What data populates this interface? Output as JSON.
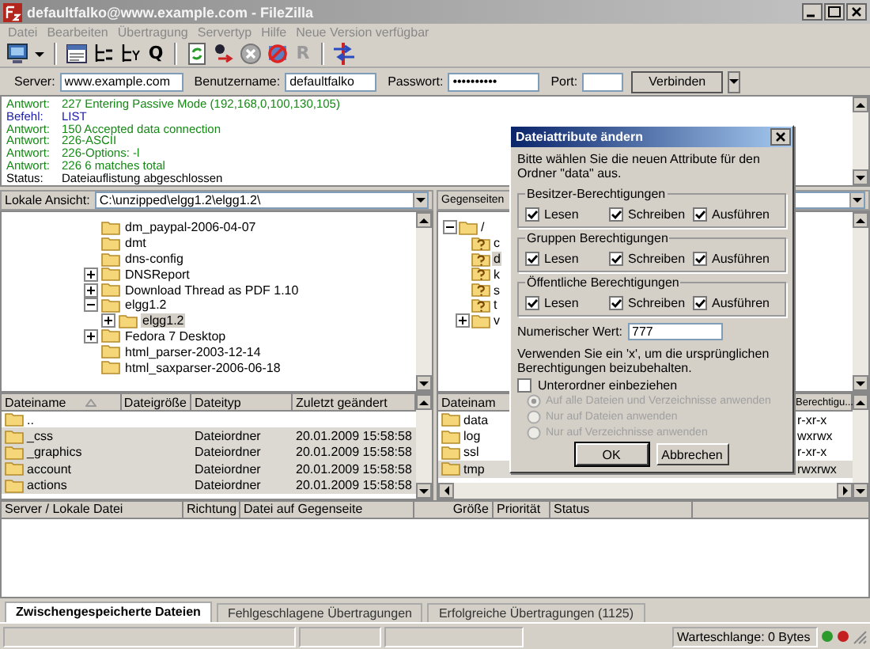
{
  "window": {
    "title": "defaultfalko@www.example.com - FileZilla"
  },
  "menu": [
    "Datei",
    "Bearbeiten",
    "Übertragung",
    "Servertyp",
    "Hilfe",
    "Neue Version verfügbar"
  ],
  "toolbar": [
    [
      {
        "kind": "site-manager"
      },
      {
        "kind": "menu-caret"
      }
    ],
    [
      {
        "kind": "message-log"
      },
      {
        "kind": "local-tree"
      },
      {
        "kind": "remote-tree"
      },
      {
        "kind": "queue",
        "text": "Q"
      }
    ],
    [
      {
        "kind": "refresh"
      },
      {
        "kind": "process-queue"
      },
      {
        "kind": "cancel"
      },
      {
        "kind": "disconnect"
      },
      {
        "kind": "reconnect",
        "text": "R",
        "disabled": true
      }
    ],
    [
      {
        "kind": "compare"
      }
    ]
  ],
  "quickconnect": {
    "server_label": "Server:",
    "server": "www.example.com",
    "user_label": "Benutzername:",
    "user": "defaultfalko",
    "password_label": "Passwort:",
    "password": "••••••••••",
    "port_label": "Port:",
    "button": "Verbinden"
  },
  "log": [
    {
      "kind": "response",
      "label": "Antwort:",
      "text": "227 Entering Passive Mode (192,168,0,100,130,105)"
    },
    {
      "kind": "command",
      "label": "Befehl:",
      "text": "LIST"
    },
    {
      "kind": "response",
      "label": "Antwort:",
      "text": "150 Accepted data connection"
    },
    {
      "kind": "response",
      "label": "Antwort:",
      "text": "226-ASCII"
    },
    {
      "kind": "response",
      "label": "Antwort:",
      "text": "226-Options: -l"
    },
    {
      "kind": "response",
      "label": "Antwort:",
      "text": "226 6 matches total"
    },
    {
      "kind": "status",
      "label": "Status:",
      "text": "Dateiauflistung abgeschlossen"
    }
  ],
  "local": {
    "label": "Lokale Ansicht:",
    "path": "C:\\unzipped\\elgg1.2\\elgg1.2\\",
    "tree": [
      {
        "name": "dm_paypal-2006-04-07"
      },
      {
        "name": "dmt"
      },
      {
        "name": "dns-config"
      },
      {
        "name": "DNSReport",
        "expanded": false
      },
      {
        "name": "Download Thread as PDF 1.10",
        "expanded": false
      },
      {
        "name": "elgg1.2",
        "expanded": true,
        "children": [
          {
            "name": "elgg1.2",
            "expanded": false,
            "selected": true
          }
        ]
      },
      {
        "name": "Fedora 7 Desktop",
        "expanded": false
      },
      {
        "name": "html_parser-2003-12-14"
      },
      {
        "name": "html_saxparser-2006-06-18"
      }
    ],
    "list": {
      "columns": [
        "Dateiname",
        "Dateigröße",
        "Dateityp",
        "Zuletzt geändert"
      ],
      "rows": [
        {
          "name": "..",
          "selected": false
        },
        {
          "name": "_css",
          "type": "Dateiordner",
          "modified": "20.01.2009 15:58:58",
          "selected": true
        },
        {
          "name": "_graphics",
          "type": "Dateiordner",
          "modified": "20.01.2009 15:58:58",
          "selected": true
        },
        {
          "name": "account",
          "type": "Dateiordner",
          "modified": "20.01.2009 15:58:58",
          "selected": true
        },
        {
          "name": "actions",
          "type": "Dateiordner",
          "modified": "20.01.2009 15:58:58",
          "selected": true
        }
      ]
    }
  },
  "remote": {
    "label": "Gegenseiten",
    "tree": [
      {
        "name": "/",
        "expanded": true,
        "children": [
          {
            "name": "c",
            "kind": "unknown"
          },
          {
            "name": "d",
            "kind": "unknown",
            "selected": true
          },
          {
            "name": "k",
            "kind": "unknown"
          },
          {
            "name": "s",
            "kind": "unknown"
          },
          {
            "name": "t",
            "kind": "unknown"
          },
          {
            "name": "v",
            "kind": "folder",
            "expanded": false
          }
        ]
      }
    ],
    "list": {
      "columns": [
        "Dateinam",
        "Berechtigu..."
      ],
      "rows": [
        {
          "name": "data",
          "permissions": "r-xr-x",
          "selected": false
        },
        {
          "name": "log",
          "permissions": "wxrwx",
          "selected": false
        },
        {
          "name": "ssl",
          "permissions": "r-xr-x",
          "selected": false
        },
        {
          "name": "tmp",
          "permissions": "rwxrwx",
          "selected": true
        }
      ]
    }
  },
  "dialog": {
    "title": "Dateiattribute ändern",
    "intro": "Bitte wählen Sie die neuen Attribute für den Ordner \"data\" aus.",
    "groups": [
      {
        "title": "Besitzer-Berechtigungen",
        "permissions": [
          {
            "label": "Lesen",
            "checked": true
          },
          {
            "label": "Schreiben",
            "checked": true
          },
          {
            "label": "Ausführen",
            "checked": true
          }
        ]
      },
      {
        "title": "Gruppen Berechtigungen",
        "permissions": [
          {
            "label": "Lesen",
            "checked": true
          },
          {
            "label": "Schreiben",
            "checked": true
          },
          {
            "label": "Ausführen",
            "checked": true
          }
        ]
      },
      {
        "title": "Öffentliche Berechtigungen",
        "permissions": [
          {
            "label": "Lesen",
            "checked": true
          },
          {
            "label": "Schreiben",
            "checked": true
          },
          {
            "label": "Ausführen",
            "checked": true
          }
        ]
      }
    ],
    "numeric_label": "Numerischer Wert:",
    "numeric_value": "777",
    "note": "Verwenden Sie ein 'x', um die ursprünglichen Berechtigungen beizubehalten.",
    "recurse": {
      "label": "Unterordner einbeziehen",
      "checked": false
    },
    "apply_options": [
      {
        "label": "Auf alle Dateien und Verzeichnisse anwenden",
        "selected": true,
        "disabled": true
      },
      {
        "label": "Nur auf Dateien anwenden",
        "selected": false,
        "disabled": true
      },
      {
        "label": "Nur auf Verzeichnisse anwenden",
        "selected": false,
        "disabled": true
      }
    ],
    "buttons": [
      "OK",
      "Abbrechen"
    ]
  },
  "queue": {
    "columns": [
      "Server / Lokale Datei",
      "Richtung",
      "Datei auf Gegenseite",
      "Größe",
      "Priorität",
      "Status"
    ]
  },
  "tabs": [
    {
      "label": "Zwischengespeicherte Dateien",
      "selected": true
    },
    {
      "label": "Fehlgeschlagene Übertragungen",
      "selected": false
    },
    {
      "label": "Erfolgreiche Übertragungen (1125)",
      "selected": false
    }
  ],
  "status_bar": {
    "queue": "Warteschlange: 0 Bytes"
  }
}
